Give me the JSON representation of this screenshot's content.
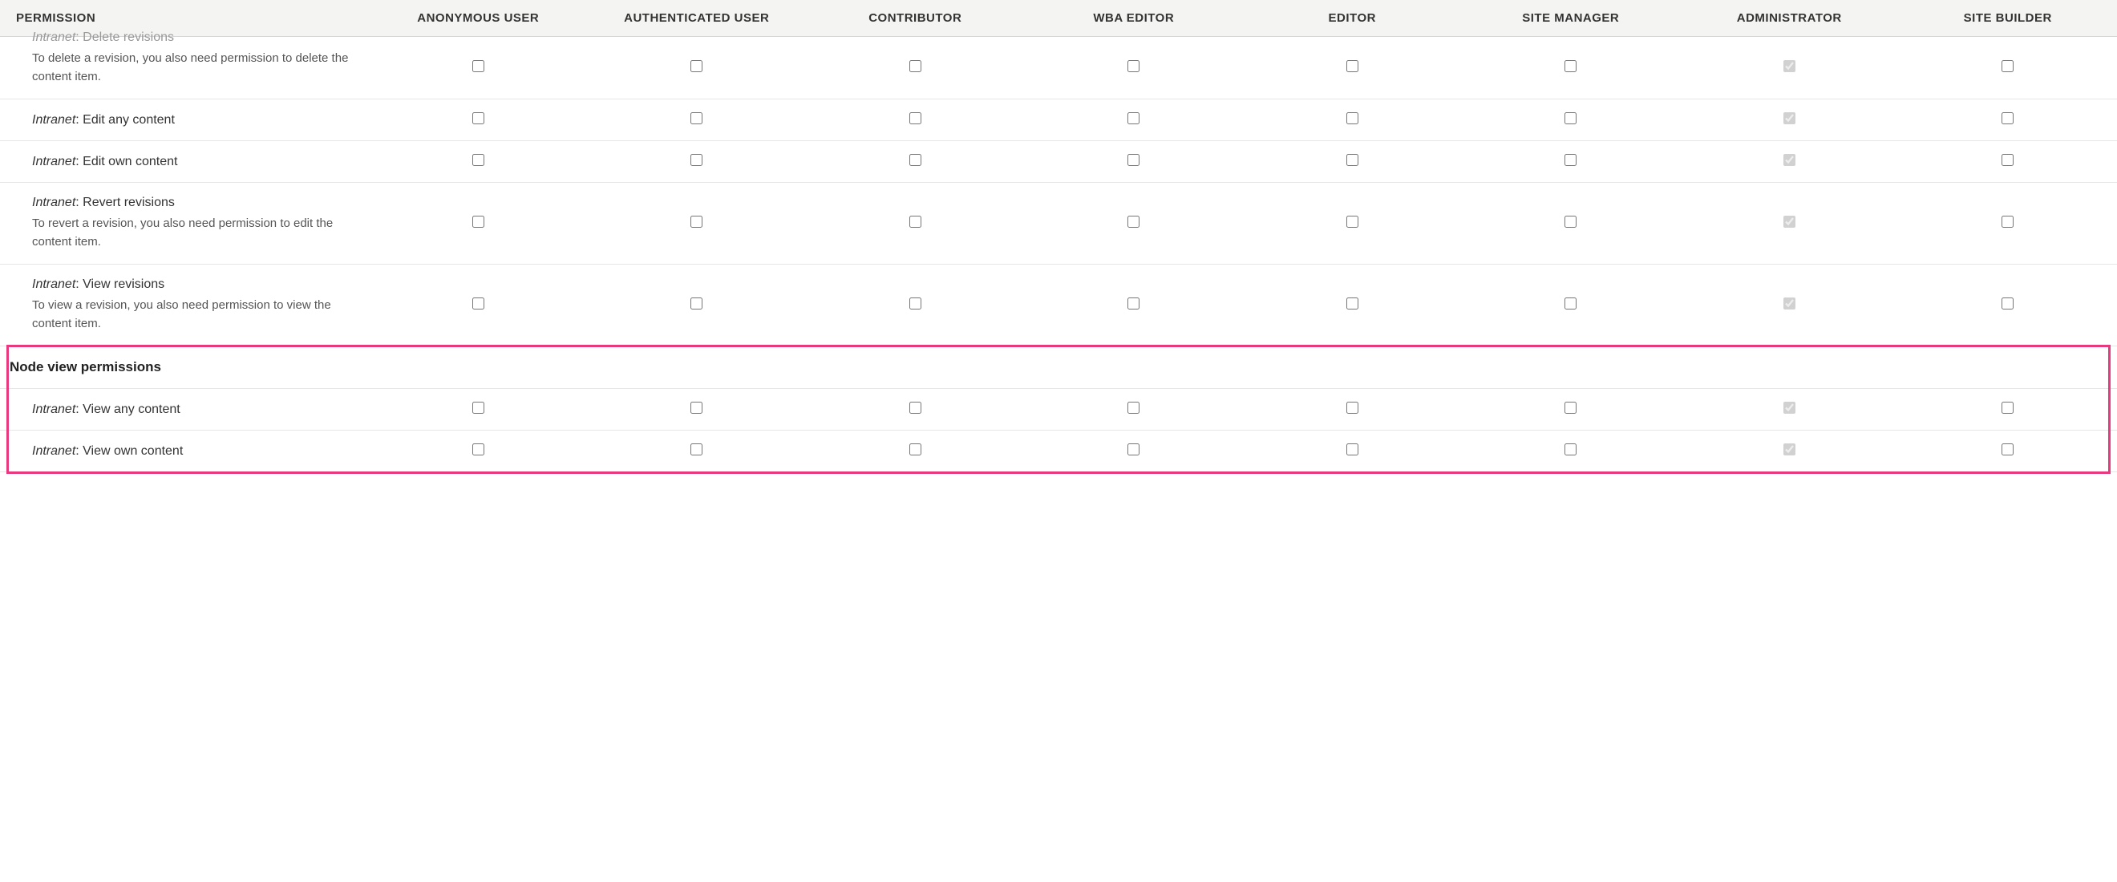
{
  "headers": {
    "permission": "PERMISSION",
    "roles": [
      "ANONYMOUS USER",
      "AUTHENTICATED USER",
      "CONTRIBUTOR",
      "WBA EDITOR",
      "EDITOR",
      "SITE MANAGER",
      "ADMINISTRATOR",
      "SITE BUILDER"
    ]
  },
  "rows": [
    {
      "prefix": "Intranet",
      "title": "Delete revisions",
      "desc": "To delete a revision, you also need permission to delete the content item.",
      "partial_top": true,
      "checks": [
        false,
        false,
        false,
        false,
        false,
        false,
        true,
        false
      ],
      "disabled": [
        false,
        false,
        false,
        false,
        false,
        false,
        true,
        false
      ]
    },
    {
      "prefix": "Intranet",
      "title": "Edit any content",
      "desc": "",
      "checks": [
        false,
        false,
        false,
        false,
        false,
        false,
        true,
        false
      ],
      "disabled": [
        false,
        false,
        false,
        false,
        false,
        false,
        true,
        false
      ]
    },
    {
      "prefix": "Intranet",
      "title": "Edit own content",
      "desc": "",
      "checks": [
        false,
        false,
        false,
        false,
        false,
        false,
        true,
        false
      ],
      "disabled": [
        false,
        false,
        false,
        false,
        false,
        false,
        true,
        false
      ]
    },
    {
      "prefix": "Intranet",
      "title": "Revert revisions",
      "desc": "To revert a revision, you also need permission to edit the content item.",
      "checks": [
        false,
        false,
        false,
        false,
        false,
        false,
        true,
        false
      ],
      "disabled": [
        false,
        false,
        false,
        false,
        false,
        false,
        true,
        false
      ]
    },
    {
      "prefix": "Intranet",
      "title": "View revisions",
      "desc": "To view a revision, you also need permission to view the content item.",
      "checks": [
        false,
        false,
        false,
        false,
        false,
        false,
        true,
        false
      ],
      "disabled": [
        false,
        false,
        false,
        false,
        false,
        false,
        true,
        false
      ]
    },
    {
      "section": "Node view permissions"
    },
    {
      "prefix": "Intranet",
      "title": "View any content",
      "desc": "",
      "checks": [
        false,
        false,
        false,
        false,
        false,
        false,
        true,
        false
      ],
      "disabled": [
        false,
        false,
        false,
        false,
        false,
        false,
        true,
        false
      ]
    },
    {
      "prefix": "Intranet",
      "title": "View own content",
      "desc": "",
      "checks": [
        false,
        false,
        false,
        false,
        false,
        false,
        true,
        false
      ],
      "disabled": [
        false,
        false,
        false,
        false,
        false,
        false,
        true,
        false
      ]
    }
  ],
  "highlight": {
    "top_row_index": 5,
    "bottom_row_index": 7
  }
}
